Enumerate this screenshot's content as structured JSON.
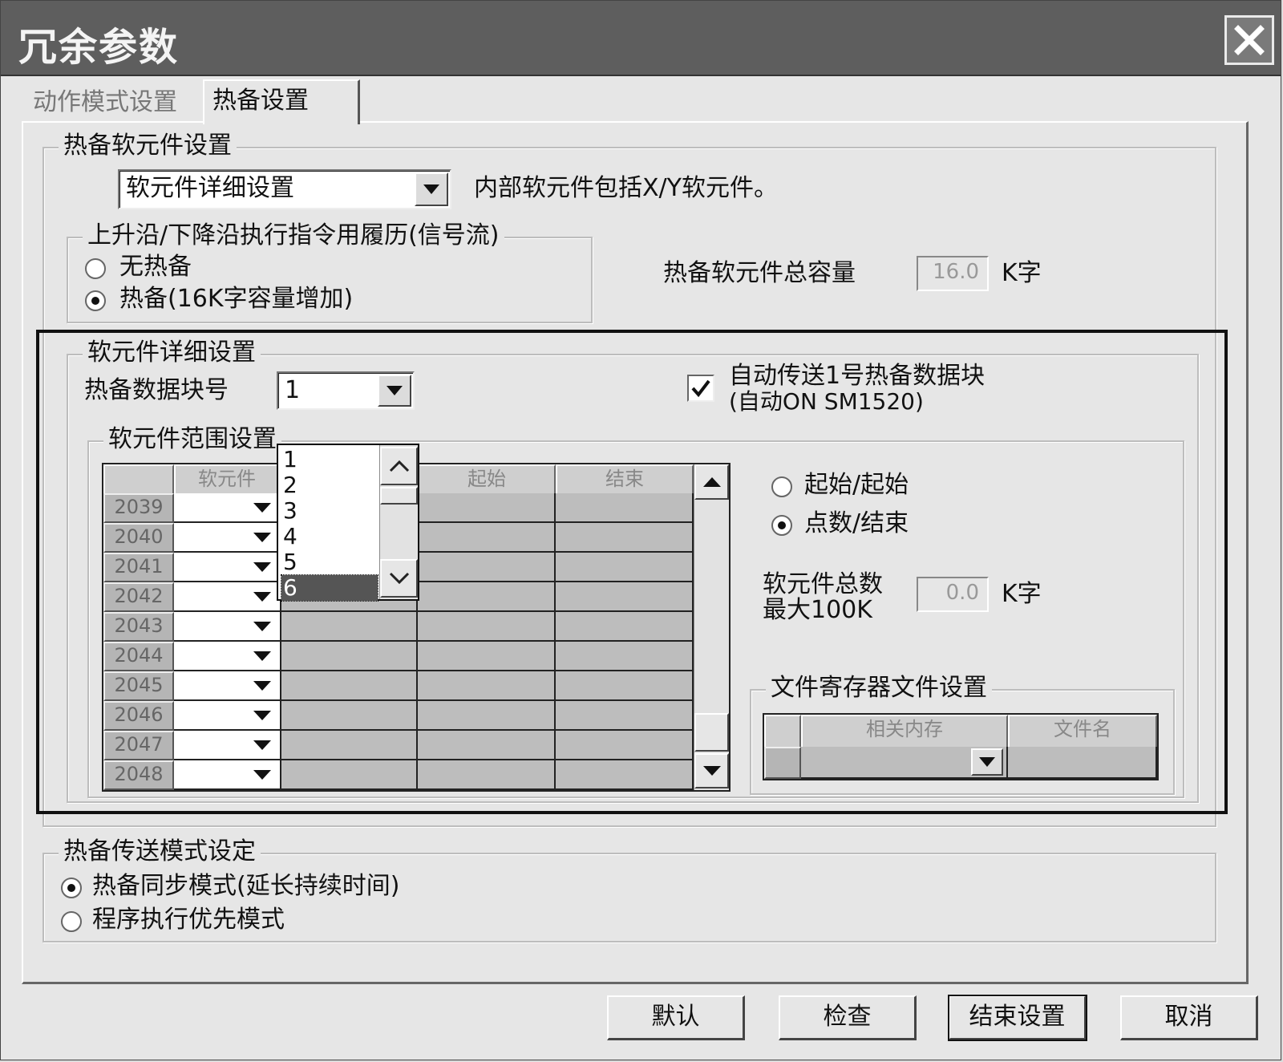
{
  "window": {
    "title": "冗余参数"
  },
  "tabs": [
    {
      "label": "动作模式设置",
      "active": false
    },
    {
      "label": "热备设置",
      "active": true
    }
  ],
  "device_settings": {
    "legend": "热备软元件设置",
    "mode_select": "软元件详细设置",
    "note": "内部软元件包括X/Y软元件。",
    "total_capacity_label": "热备软元件总容量",
    "total_capacity_value": "16.0",
    "total_capacity_unit": "K字"
  },
  "edge_history": {
    "legend": "上升沿/下降沿执行指令用履历(信号流)",
    "options": [
      {
        "label": "无热备",
        "selected": false
      },
      {
        "label": "热备(16K字容量增加)",
        "selected": true
      }
    ]
  },
  "detail": {
    "legend": "软元件详细设置",
    "block_label": "热备数据块号",
    "block_value": "1",
    "auto_transfer_line1": "自动传送1号热备数据块",
    "auto_transfer_line2": "(自动ON SM1520)",
    "auto_transfer_checked": true,
    "dropdown_items": [
      "1",
      "2",
      "3",
      "4",
      "5",
      "6"
    ],
    "dropdown_selected": "6"
  },
  "range": {
    "legend": "软元件范围设置",
    "columns": [
      "软元件",
      "起始",
      "结束"
    ],
    "rows": [
      "2039",
      "2040",
      "2041",
      "2042",
      "2043",
      "2044",
      "2045",
      "2046",
      "2047",
      "2048"
    ],
    "mode_options": [
      {
        "label": "起始/起始",
        "selected": false
      },
      {
        "label": "点数/结束",
        "selected": true
      }
    ],
    "total_label_line1": "软元件总数",
    "total_label_line2": "最大100K",
    "total_value": "0.0",
    "total_unit": "K字"
  },
  "file_register": {
    "legend": "文件寄存器文件设置",
    "columns": [
      "相关内存",
      "文件名"
    ]
  },
  "transfer_mode": {
    "legend": "热备传送模式设定",
    "options": [
      {
        "label": "热备同步模式(延长持续时间)",
        "selected": true
      },
      {
        "label": "程序执行优先模式",
        "selected": false
      }
    ]
  },
  "buttons": {
    "default": "默认",
    "check": "检查",
    "finish": "结束设置",
    "cancel": "取消"
  },
  "colors": {
    "titlebar": "#5e5e5e",
    "dialog": "#e6e6e6",
    "grid_cell": "#bdbdbd"
  }
}
